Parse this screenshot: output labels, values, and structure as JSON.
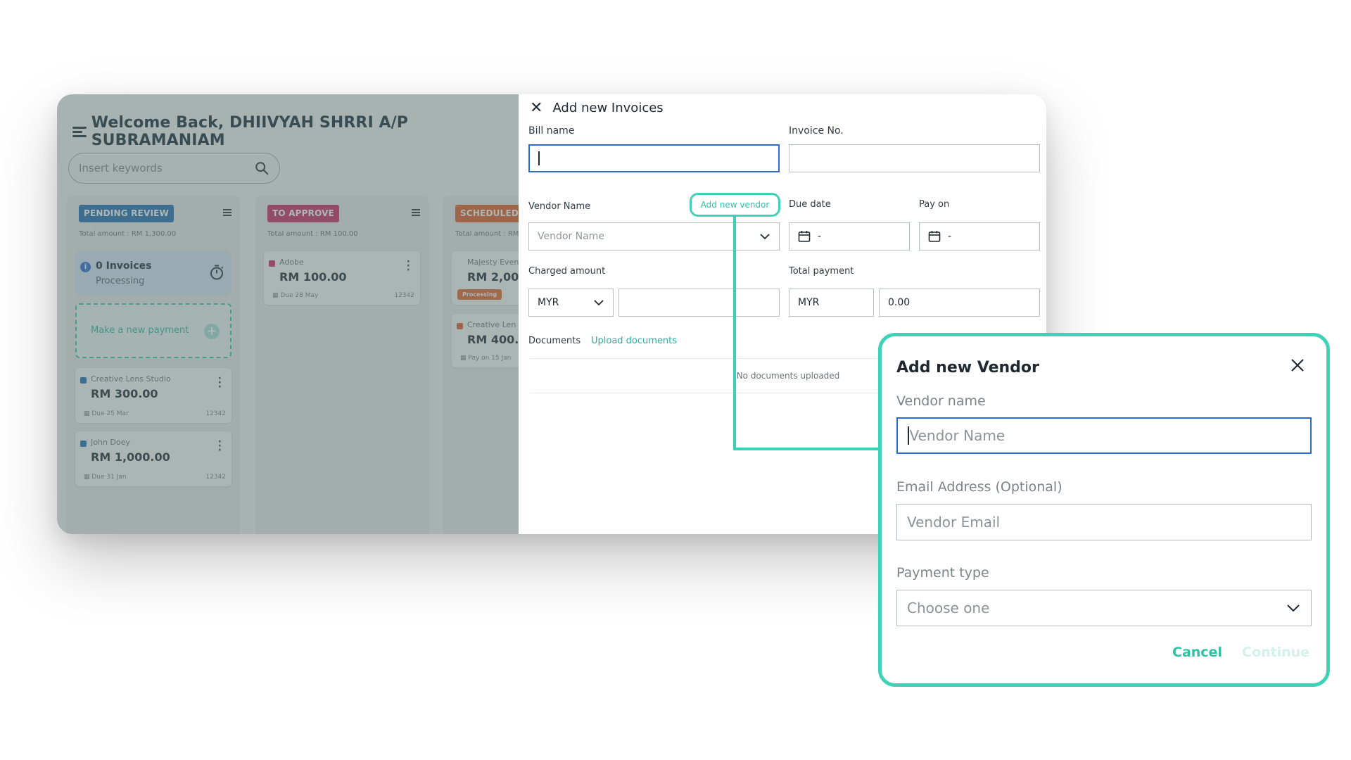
{
  "dashboard": {
    "welcome": "Welcome Back, DHIIVYAH SHRRI A/P SUBRAMANIAM",
    "search_placeholder": "Insert keywords",
    "columns": [
      {
        "tag": "PENDING REVIEW",
        "tag_color": "#1f6db3",
        "total": "Total amount : RM 1,300.00",
        "info": {
          "title": "0 Invoices",
          "subtitle": "Processing"
        },
        "new_payment": "Make a new payment",
        "cards": [
          {
            "vendor": "Creative Lens Studio",
            "amount": "RM 300.00",
            "due": "Due 25 Mar",
            "number": "12342",
            "dot_color": "#1f6db3"
          },
          {
            "vendor": "John Doey",
            "amount": "RM 1,000.00",
            "due": "Due 31 Jan",
            "number": "12342",
            "dot_color": "#1f6db3"
          }
        ]
      },
      {
        "tag": "TO APPROVE",
        "tag_color": "#c9295f",
        "total": "Total amount : RM 100.00",
        "cards": [
          {
            "vendor": "Adobe",
            "amount": "RM 100.00",
            "due": "Due 28 May",
            "number": "12342",
            "dot_color": "#c9295f"
          }
        ]
      },
      {
        "tag": "SCHEDULED",
        "tag_color": "#e15a22",
        "total": "Total amount : RM",
        "cards": [
          {
            "vendor": "Majesty Even",
            "amount": "RM 2,00",
            "badge": "Processing"
          },
          {
            "vendor": "Creative Len",
            "amount": "RM 400.",
            "due": "Pay on 15 Jan",
            "dot_color": "#e15a22"
          }
        ]
      }
    ]
  },
  "invoice_panel": {
    "title": "Add new Invoices",
    "bill_name_label": "Bill name",
    "invoice_no_label": "Invoice No.",
    "vendor_name_label": "Vendor Name",
    "add_vendor_link": "Add new vendor",
    "vendor_placeholder": "Vendor Name",
    "due_date_label": "Due date",
    "due_date_value": "-",
    "pay_on_label": "Pay on",
    "pay_on_value": "-",
    "charged_amount_label": "Charged amount",
    "charged_currency": "MYR",
    "total_payment_label": "Total payment",
    "total_currency": "MYR",
    "total_value": "0.00",
    "documents_label": "Documents",
    "upload_link": "Upload documents",
    "no_docs": "No documents uploaded"
  },
  "vendor_modal": {
    "title": "Add new Vendor",
    "vendor_name_label": "Vendor name",
    "vendor_name_placeholder": "Vendor Name",
    "email_label": "Email Address (Optional)",
    "email_placeholder": "Vendor Email",
    "payment_type_label": "Payment type",
    "payment_type_placeholder": "Choose one",
    "cancel": "Cancel",
    "continue": "Continue"
  },
  "colors": {
    "accent": "#3fd2b6",
    "focus": "#2a6bd6"
  }
}
